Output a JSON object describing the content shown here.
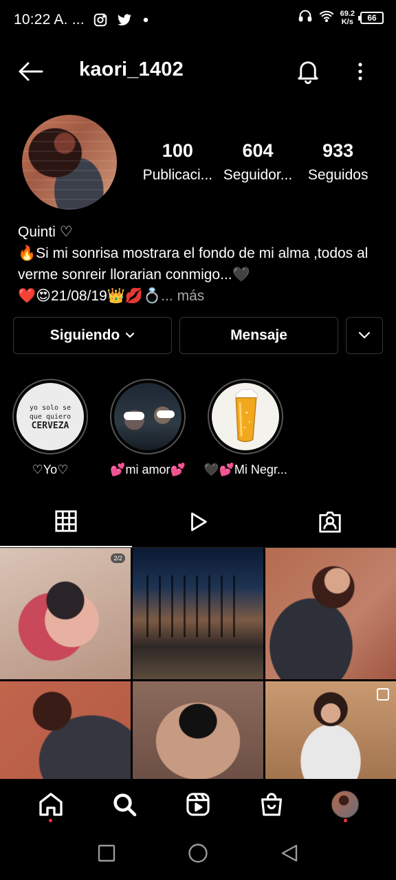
{
  "status_bar": {
    "time": "10:22 A. ...",
    "net_speed_value": "69.2",
    "net_speed_unit": "K/s",
    "battery": "66"
  },
  "header": {
    "username": "kaori_1402"
  },
  "profile": {
    "stats": [
      {
        "value": "100",
        "label": "Publicaci..."
      },
      {
        "value": "604",
        "label": "Seguidor..."
      },
      {
        "value": "933",
        "label": "Seguidos"
      }
    ],
    "bio": {
      "name": "Quinti ♡",
      "line1": "🔥Si mi sonrisa mostrara el fondo de mi alma ,todos al verme sonreir llorarian conmigo...🖤",
      "line2": "❤️😍21/08/19👑💋💍",
      "more": "... más"
    }
  },
  "actions": {
    "following_label": "Siguiendo",
    "message_label": "Mensaje"
  },
  "highlights": [
    {
      "label": "♡Yo♡",
      "image_text": [
        "yo solo se",
        "que quiero",
        "CERVEZA"
      ]
    },
    {
      "label": "💕mi amor💕"
    },
    {
      "label": "🖤💕Mi Negr..."
    }
  ],
  "grid_posts": [
    {
      "badge": "2/2"
    },
    {},
    {},
    {},
    {},
    {
      "multi": true
    }
  ],
  "colors": {
    "background": "#000000",
    "text": "#ffffff",
    "secondary_text": "#a8a8a8",
    "button_border": "#363636",
    "notification_dot": "#ff3040"
  }
}
